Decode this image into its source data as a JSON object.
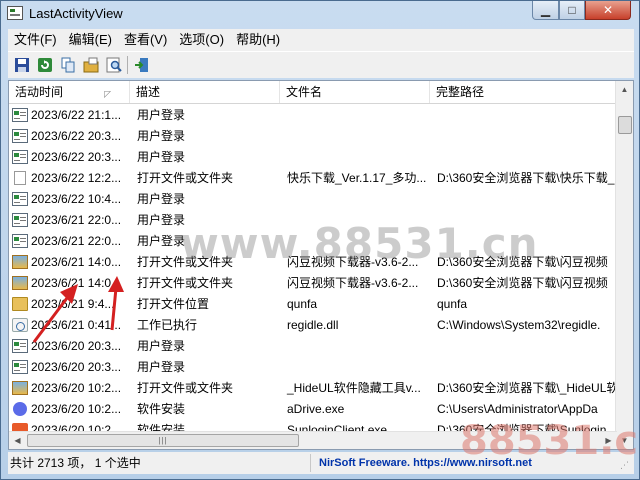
{
  "window": {
    "title": "LastActivityView",
    "controls": {
      "minimize": "▁",
      "maximize": "□",
      "close": "✕"
    }
  },
  "menubar": {
    "items": [
      "文件(F)",
      "编辑(E)",
      "查看(V)",
      "选项(O)",
      "帮助(H)"
    ]
  },
  "toolbar": {
    "buttons": [
      "save-icon",
      "refresh-icon",
      "copy-icon",
      "properties-icon",
      "find-icon",
      "exit-icon"
    ]
  },
  "listview": {
    "columns": [
      "活动时间",
      "描述",
      "文件名",
      "完整路径"
    ],
    "sort_column": "活动时间",
    "rows": [
      {
        "icon": "login",
        "time": "2023/6/22 21:1...",
        "desc": "用户登录",
        "file": "",
        "path": ""
      },
      {
        "icon": "login",
        "time": "2023/6/22 20:3...",
        "desc": "用户登录",
        "file": "",
        "path": ""
      },
      {
        "icon": "login",
        "time": "2023/6/22 20:3...",
        "desc": "用户登录",
        "file": "",
        "path": ""
      },
      {
        "icon": "file",
        "time": "2023/6/22 12:2...",
        "desc": "打开文件或文件夹",
        "file": "快乐下载_Ver.1.17_多功...",
        "path": "D:\\360安全浏览器下载\\快乐下载_"
      },
      {
        "icon": "login",
        "time": "2023/6/22 10:4...",
        "desc": "用户登录",
        "file": "",
        "path": ""
      },
      {
        "icon": "login",
        "time": "2023/6/21 22:0...",
        "desc": "用户登录",
        "file": "",
        "path": ""
      },
      {
        "icon": "login",
        "time": "2023/6/21 22:0...",
        "desc": "用户登录",
        "file": "",
        "path": ""
      },
      {
        "icon": "folderimg",
        "time": "2023/6/21 14:0...",
        "desc": "打开文件或文件夹",
        "file": "闪豆视频下载器-v3.6-2...",
        "path": "D:\\360安全浏览器下载\\闪豆视频"
      },
      {
        "icon": "folderimg",
        "time": "2023/6/21 14:0...",
        "desc": "打开文件或文件夹",
        "file": "闪豆视频下载器-v3.6-2...",
        "path": "D:\\360安全浏览器下载\\闪豆视频"
      },
      {
        "icon": "folder",
        "time": "2023/6/21 9:4...",
        "desc": "打开文件位置",
        "file": "qunfa",
        "path": "qunfa"
      },
      {
        "icon": "dll",
        "time": "2023/6/21 0:41...",
        "desc": "工作已执行",
        "file": "regidle.dll",
        "path": "C:\\Windows\\System32\\regidle."
      },
      {
        "icon": "login",
        "time": "2023/6/20 20:3...",
        "desc": "用户登录",
        "file": "",
        "path": ""
      },
      {
        "icon": "login",
        "time": "2023/6/20 20:3...",
        "desc": "用户登录",
        "file": "",
        "path": ""
      },
      {
        "icon": "folderimg",
        "time": "2023/6/20 10:2...",
        "desc": "打开文件或文件夹",
        "file": "_HideUL软件隐藏工具v...",
        "path": "D:\\360安全浏览器下载\\_HideUL软"
      },
      {
        "icon": "setup",
        "time": "2023/6/20 10:2...",
        "desc": "软件安装",
        "file": "aDrive.exe",
        "path": "C:\\Users\\Administrator\\AppDa"
      },
      {
        "icon": "setup2",
        "time": "2023/6/20 10:2...",
        "desc": "软件安装",
        "file": "SunloginClient.exe",
        "path": "D:\\360安全浏览器下载\\Sunlogin"
      }
    ]
  },
  "statusbar": {
    "count_text": "共计 2713 项， 1 个选中",
    "link_text": "NirSoft Freeware. https://www.nirsoft.net"
  },
  "watermark": {
    "main": "www.88531.cn",
    "corner": "88531.cn"
  },
  "colors": {
    "frame": "#b7cfe8",
    "close_button": "#c7402b",
    "link": "#0033aa",
    "annotation_arrow": "#d42020"
  }
}
